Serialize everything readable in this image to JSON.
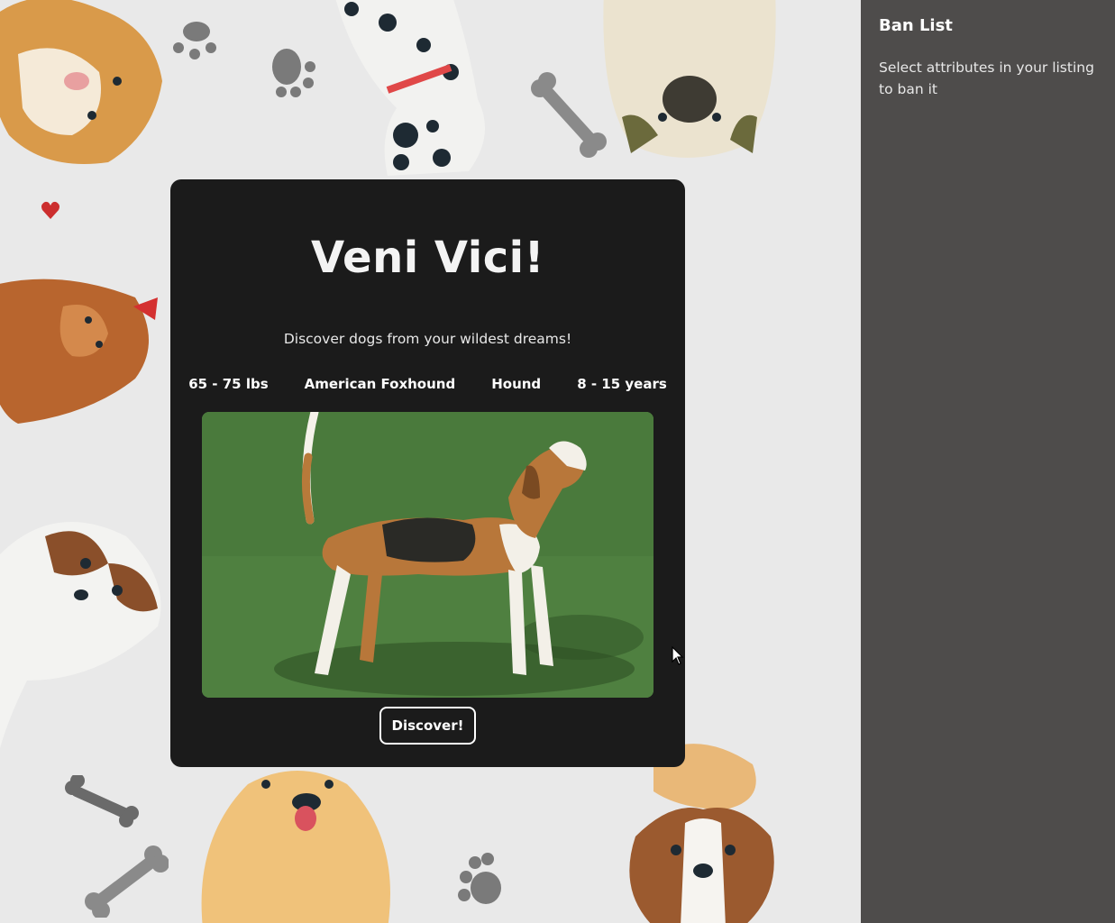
{
  "main": {
    "title": "Veni Vici!",
    "subtitle": "Discover dogs from your wildest dreams!",
    "attributes": [
      "65 - 75 lbs",
      "American Foxhound",
      "Hound",
      "8 - 15 years"
    ],
    "image_subject": "American Foxhound standing on grass",
    "discover_label": "Discover!"
  },
  "sidebar": {
    "title": "Ban List",
    "hint": "Select attributes in your listing to ban it"
  },
  "colors": {
    "card_bg": "#1b1b1b",
    "sidebar_bg": "#4e4c4b",
    "page_bg": "#e9e9e9"
  }
}
